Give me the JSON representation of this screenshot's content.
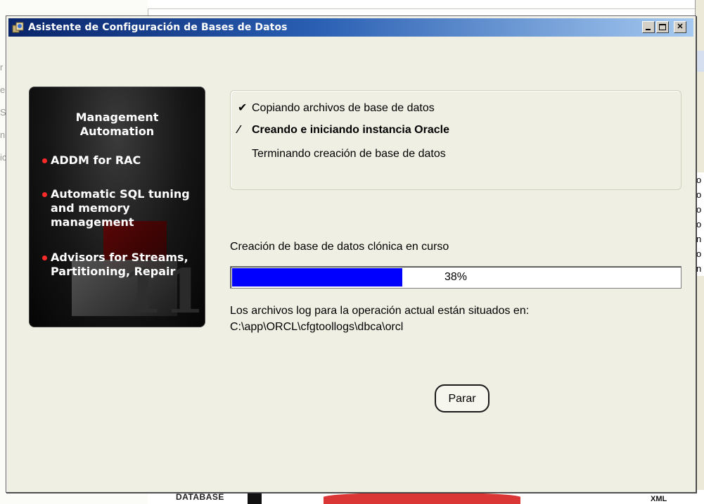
{
  "window": {
    "title": "Asistente de Configuración de Bases de Datos",
    "buttons": {
      "minimize": "minimize",
      "maximize": "maximize",
      "close": "✕"
    }
  },
  "promo": {
    "heading_line1": "Management",
    "heading_line2": "Automation",
    "items": [
      "ADDM for RAC",
      "Automatic SQL tuning and memory management",
      "Advisors for Streams, Partitioning, Repair"
    ],
    "logo_mark": "11g"
  },
  "steps": [
    {
      "label": "Copiando archivos de base de datos",
      "status": "done",
      "mark": "✔"
    },
    {
      "label": "Creando e iniciando instancia Oracle",
      "status": "in-progress",
      "mark": "⁄"
    },
    {
      "label": "Terminando creación de base de datos",
      "status": "pending",
      "mark": ""
    }
  ],
  "progress": {
    "label": "Creación de base de datos clónica en curso",
    "percent": 38,
    "percent_text": "38%",
    "accent": "#0000ff"
  },
  "log": {
    "line1": "Los archivos log para la operación actual están situados en:",
    "line2": "C:\\app\\ORCL\\cfgtoollogs\\dbca\\orcl"
  },
  "actions": {
    "stop_label": "Parar"
  },
  "background": {
    "db_label": "DATABASE",
    "xml_label": "XML",
    "right_list_fragments": [
      "o",
      "o",
      "o",
      "o",
      "n",
      "o",
      "n"
    ]
  }
}
